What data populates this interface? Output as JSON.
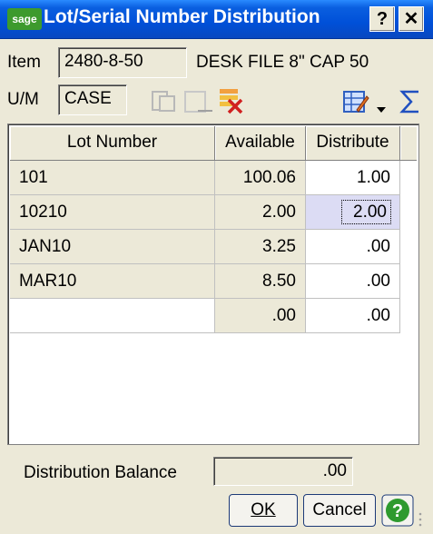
{
  "window": {
    "logo_text": "sage",
    "title": "Lot/Serial Number Distribution",
    "help_label": "?",
    "close_label": "✕"
  },
  "item": {
    "label": "Item",
    "value": "2480-8-50",
    "description": "DESK FILE 8\" CAP 50"
  },
  "um": {
    "label": "U/M",
    "value": "CASE"
  },
  "toolbar": {
    "icons": [
      "copy-icon",
      "paste-icon",
      "delete-icon",
      "customize-icon",
      "dropdown-arrow-icon",
      "sum-icon"
    ]
  },
  "grid": {
    "headers": {
      "lot": "Lot Number",
      "available": "Available",
      "distribute": "Distribute"
    },
    "rows": [
      {
        "lot": "101",
        "available": "100.06",
        "distribute": "1.00"
      },
      {
        "lot": "10210",
        "available": "2.00",
        "distribute": "2.00"
      },
      {
        "lot": "JAN10",
        "available": "3.25",
        "distribute": ".00"
      },
      {
        "lot": "MAR10",
        "available": "8.50",
        "distribute": ".00"
      },
      {
        "lot": "",
        "available": ".00",
        "distribute": ".00"
      }
    ],
    "selected_row": 1
  },
  "balance": {
    "label": "Distribution Balance",
    "value": ".00"
  },
  "buttons": {
    "ok": "OK",
    "cancel": "Cancel"
  },
  "colors": {
    "title_bar": "#0050d8",
    "logo": "#3d9a2d",
    "selected_cell": "#dcdcf4"
  }
}
